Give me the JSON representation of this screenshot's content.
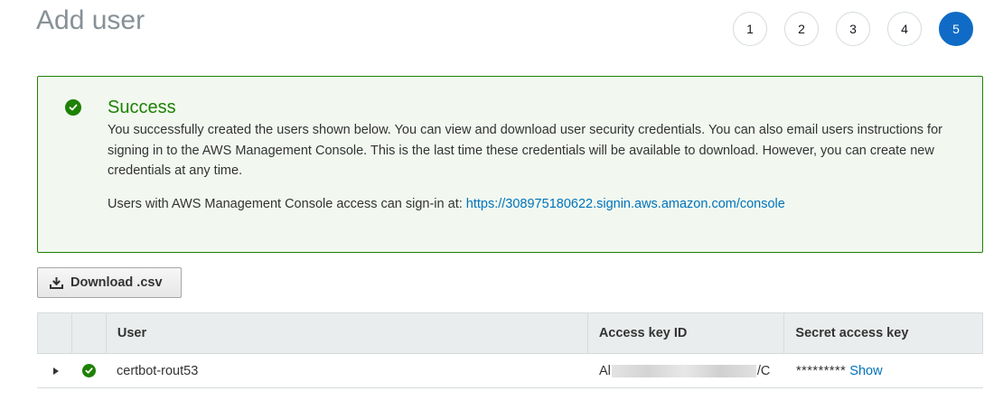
{
  "page": {
    "title": "Add user"
  },
  "steps": [
    "1",
    "2",
    "3",
    "4",
    "5"
  ],
  "active_step": "5",
  "alert": {
    "title": "Success",
    "body": "You successfully created the users shown below. You can view and download user security credentials. You can also email users instructions for signing in to the AWS Management Console. This is the last time these credentials will be available to download. However, you can create new credentials at any time.",
    "signin_text": "Users with AWS Management Console access can sign-in at: ",
    "signin_link": "https://308975180622.signin.aws.amazon.com/console",
    "icon": "check-circle-icon",
    "color": "#1d8102"
  },
  "download_button": {
    "label": "Download .csv",
    "icon": "download-icon"
  },
  "table": {
    "columns": [
      "",
      "",
      "User",
      "Access key ID",
      "Secret access key"
    ],
    "rows": [
      {
        "user": "certbot-rout53",
        "access_key_prefix": "Al",
        "access_key_suffix": "/C",
        "secret_masked": "*********",
        "secret_action": "Show"
      }
    ]
  },
  "colors": {
    "accent": "#0f6bc5",
    "link": "#0073bb",
    "success": "#1d8102"
  }
}
